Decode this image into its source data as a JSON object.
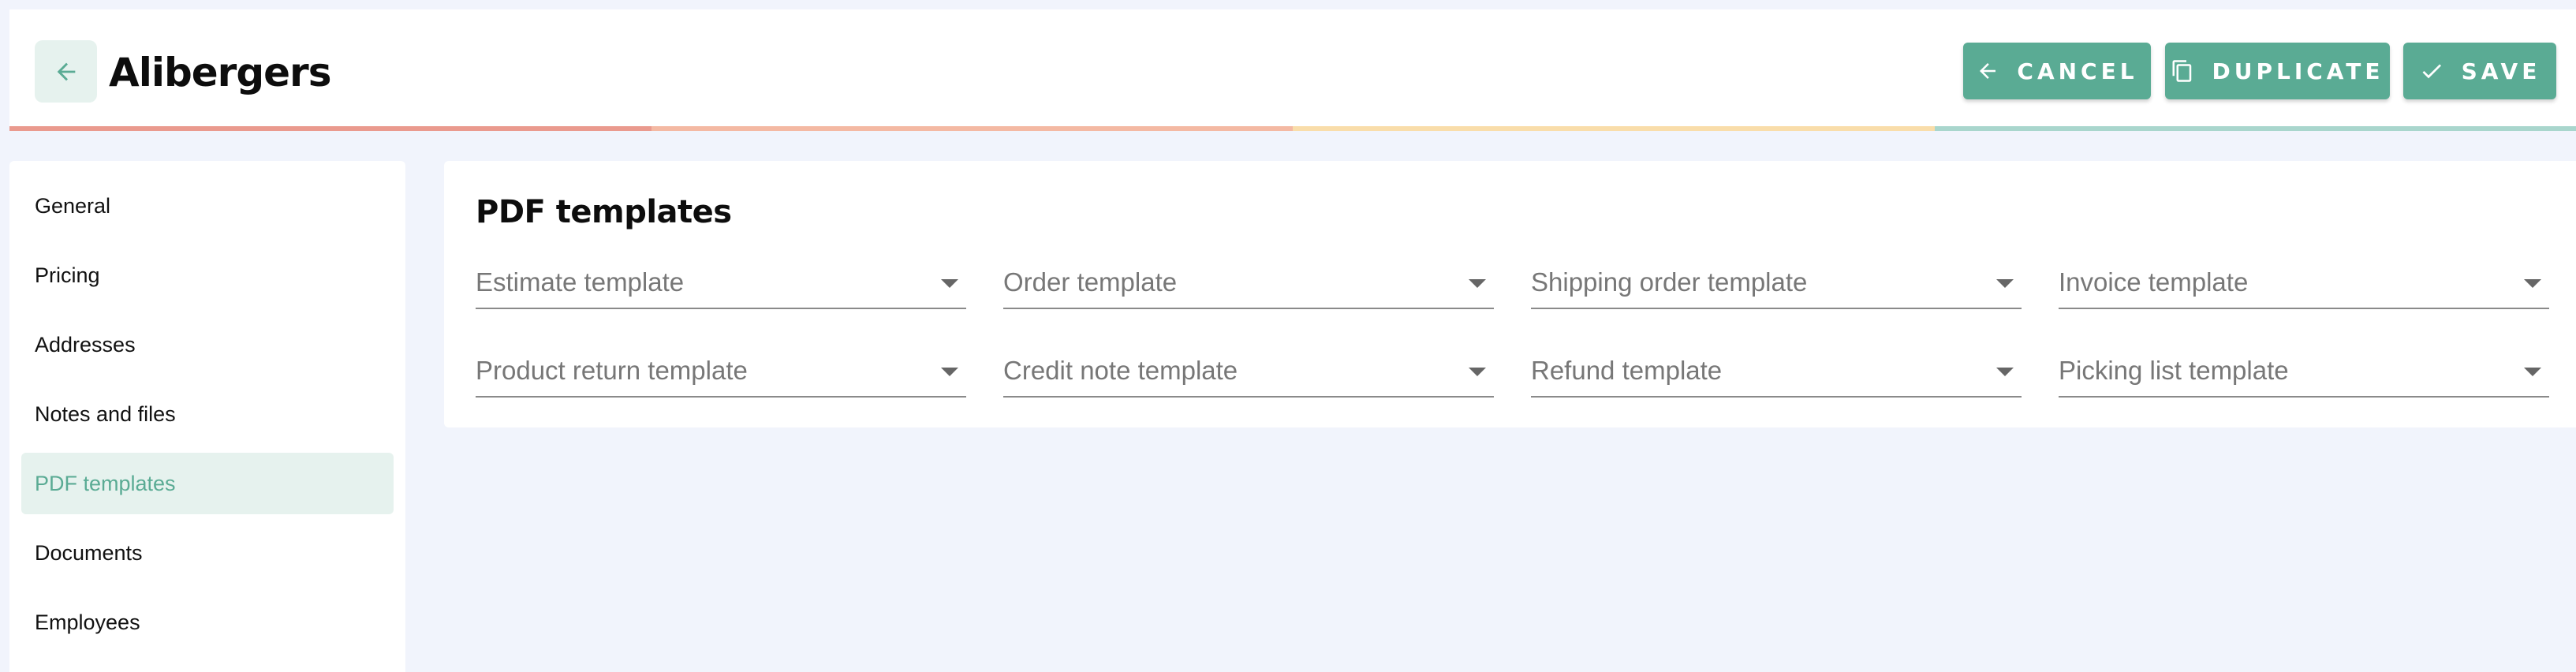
{
  "header": {
    "title": "Alibergers",
    "back_icon": "arrow-left-icon",
    "accent_colors": [
      "#ea9a8e",
      "#f4b9a3",
      "#f9ddaa",
      "#a9d6cd"
    ],
    "buttons": {
      "cancel": {
        "label": "CANCEL",
        "icon": "arrow-left-icon"
      },
      "duplicate": {
        "label": "DUPLICATE",
        "icon": "copy-icon"
      },
      "save": {
        "label": "SAVE",
        "icon": "check-icon"
      }
    },
    "button_color": "#5aab94"
  },
  "sidebar": {
    "items": [
      {
        "label": "General",
        "active": false
      },
      {
        "label": "Pricing",
        "active": false
      },
      {
        "label": "Addresses",
        "active": false
      },
      {
        "label": "Notes and files",
        "active": false
      },
      {
        "label": "PDF templates",
        "active": true
      },
      {
        "label": "Documents",
        "active": false
      },
      {
        "label": "Employees",
        "active": false
      }
    ],
    "active_color": "#5aab94",
    "active_background": "#e6f2ee"
  },
  "main": {
    "title": "PDF templates",
    "fields": [
      {
        "label": "Estimate template"
      },
      {
        "label": "Order template"
      },
      {
        "label": "Shipping order template"
      },
      {
        "label": "Invoice template"
      },
      {
        "label": "Product return template"
      },
      {
        "label": "Credit note template"
      },
      {
        "label": "Refund template"
      },
      {
        "label": "Picking list template"
      }
    ]
  }
}
